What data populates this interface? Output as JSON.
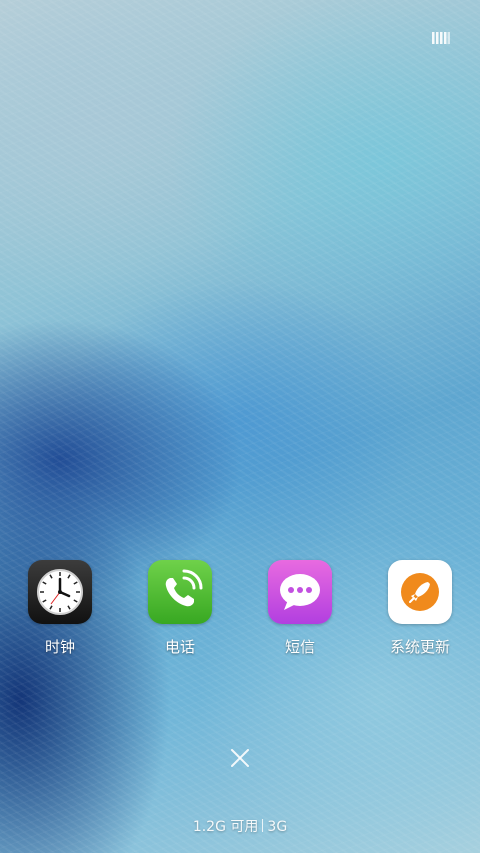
{
  "status_bar": {
    "icon": "recent-apps-icon"
  },
  "apps": [
    {
      "label": "时钟",
      "icon": "clock-icon",
      "color": "#222222"
    },
    {
      "label": "电话",
      "icon": "phone-icon",
      "color": "#4cbb30"
    },
    {
      "label": "短信",
      "icon": "message-icon",
      "color": "#cc55e0"
    },
    {
      "label": "系统更新",
      "icon": "system-update-icon",
      "color": "#f08a1c"
    }
  ],
  "close_button": {
    "icon": "close-icon"
  },
  "memory": {
    "available_label": "1.2G 可用",
    "total_label": "3G"
  }
}
